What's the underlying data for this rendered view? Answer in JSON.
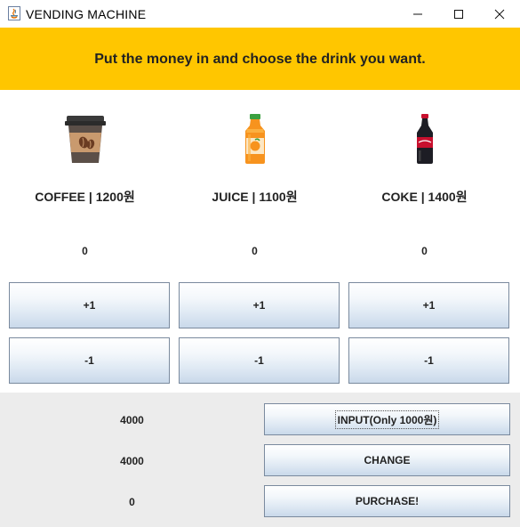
{
  "window": {
    "title": "VENDING MACHINE",
    "controls": [
      "minimize",
      "maximize",
      "close"
    ]
  },
  "banner": {
    "text": "Put the money in and choose the drink you want.",
    "color": "#ffc600"
  },
  "products": [
    {
      "name_label": "COFFEE | 1200원",
      "count": "0",
      "plus_label": "+1",
      "minus_label": "-1",
      "icon": "coffee-cup-icon"
    },
    {
      "name_label": "JUICE | 1100원",
      "count": "0",
      "plus_label": "+1",
      "minus_label": "-1",
      "icon": "juice-bottle-icon"
    },
    {
      "name_label": "COKE | 1400원",
      "count": "0",
      "plus_label": "+1",
      "minus_label": "-1",
      "icon": "coke-bottle-icon"
    }
  ],
  "money": {
    "input_value": "4000",
    "change_value": "4000",
    "purchase_value": "0",
    "input_button": "INPUT(Only 1000원)",
    "change_button": "CHANGE",
    "purchase_button": "PURCHASE!"
  }
}
